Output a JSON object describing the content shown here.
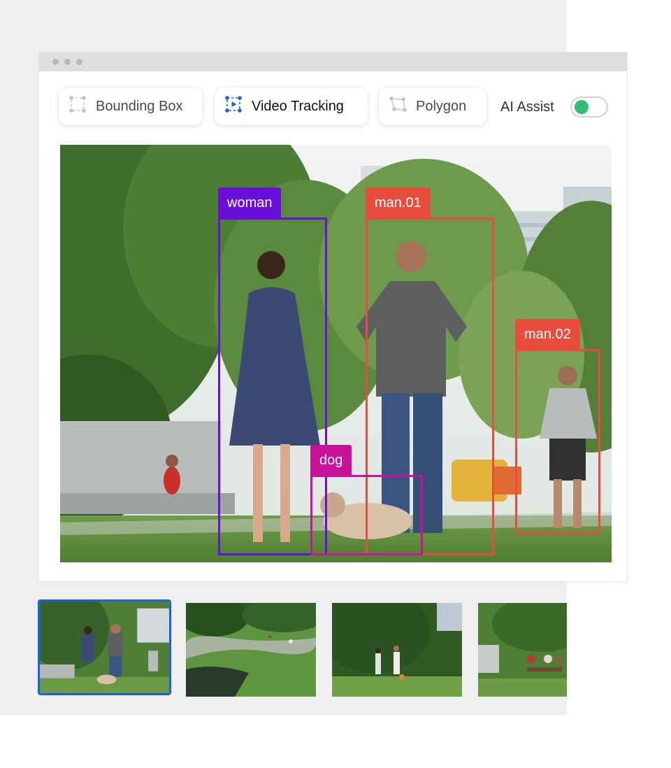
{
  "toolbar": {
    "tools": [
      {
        "label": "Bounding Box",
        "icon": "bounding-box-icon",
        "active": false
      },
      {
        "label": "Video Tracking",
        "icon": "video-tracking-icon",
        "active": true
      },
      {
        "label": "Polygon",
        "icon": "polygon-icon",
        "active": false
      }
    ],
    "ai_assist": {
      "label": "AI Assist",
      "enabled": true,
      "color": "#2fbe73"
    }
  },
  "annotations": [
    {
      "label": "woman",
      "color": "#6a0fd8"
    },
    {
      "label": "man.01",
      "color": "#e84c3d"
    },
    {
      "label": "man.02",
      "color": "#e84c3d"
    },
    {
      "label": "dog",
      "color": "#c8129a"
    }
  ],
  "filmstrip": {
    "frames": [
      {
        "icon": "park-walk-thumbnail",
        "selected": true
      },
      {
        "icon": "park-pond-thumbnail",
        "selected": false
      },
      {
        "icon": "park-couple-thumbnail",
        "selected": false
      },
      {
        "icon": "park-picnic-thumbnail",
        "selected": false
      }
    ],
    "selection_color": "#1f5fe0"
  }
}
